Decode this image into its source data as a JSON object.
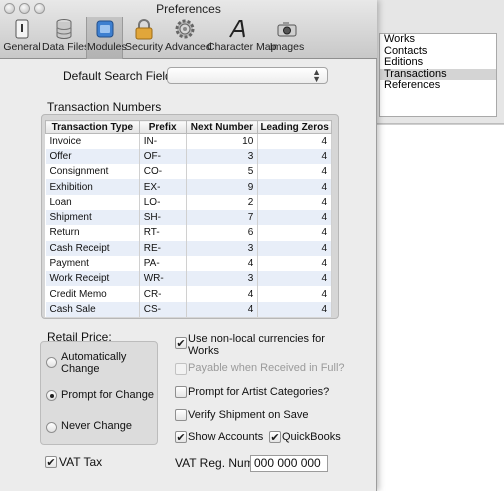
{
  "window": {
    "title": "Preferences",
    "toolbar": [
      {
        "label": "General",
        "icon": "general-icon"
      },
      {
        "label": "Data Files",
        "icon": "database-icon"
      },
      {
        "label": "Modules",
        "icon": "modules-icon",
        "selected": true
      },
      {
        "label": "Security",
        "icon": "lock-icon"
      },
      {
        "label": "Advanced",
        "icon": "gear-icon"
      },
      {
        "label": "Character Map",
        "icon": "character-map-icon"
      },
      {
        "label": "Images",
        "icon": "camera-icon"
      }
    ]
  },
  "default_search": {
    "label": "Default Search Field:",
    "value": ""
  },
  "transactions": {
    "title": "Transaction Numbers",
    "headers": [
      "Transaction Type",
      "Prefix",
      "Next Number",
      "Leading Zeros"
    ],
    "rows": [
      {
        "type": "Invoice",
        "prefix": "IN-",
        "next": "10",
        "zeros": "4"
      },
      {
        "type": "Offer",
        "prefix": "OF-",
        "next": "3",
        "zeros": "4"
      },
      {
        "type": "Consignment",
        "prefix": "CO-",
        "next": "5",
        "zeros": "4"
      },
      {
        "type": "Exhibition",
        "prefix": "EX-",
        "next": "9",
        "zeros": "4"
      },
      {
        "type": "Loan",
        "prefix": "LO-",
        "next": "2",
        "zeros": "4"
      },
      {
        "type": "Shipment",
        "prefix": "SH-",
        "next": "7",
        "zeros": "4"
      },
      {
        "type": "Return",
        "prefix": "RT-",
        "next": "6",
        "zeros": "4"
      },
      {
        "type": "Cash Receipt",
        "prefix": "RE-",
        "next": "3",
        "zeros": "4"
      },
      {
        "type": "Payment",
        "prefix": "PA-",
        "next": "4",
        "zeros": "4"
      },
      {
        "type": "Work Receipt",
        "prefix": "WR-",
        "next": "3",
        "zeros": "4"
      },
      {
        "type": "Credit Memo",
        "prefix": "CR-",
        "next": "4",
        "zeros": "4"
      },
      {
        "type": "Cash Sale",
        "prefix": "CS-",
        "next": "4",
        "zeros": "4"
      }
    ]
  },
  "retail_price": {
    "label": "Retail Price:",
    "options": [
      {
        "label": "Automatically Change",
        "selected": false
      },
      {
        "label": "Prompt for Change",
        "selected": true
      },
      {
        "label": "Never Change",
        "selected": false
      }
    ]
  },
  "checkboxes": {
    "non_local": {
      "label": "Use non-local currencies for Works",
      "checked": true
    },
    "payable": {
      "label": "Payable when Received in Full?",
      "checked": false,
      "disabled": true
    },
    "artist_categories": {
      "label": "Prompt for Artist Categories?",
      "checked": false
    },
    "verify_shipment": {
      "label": "Verify Shipment on Save",
      "checked": false
    },
    "show_accounts": {
      "label": "Show Accounts",
      "checked": true
    },
    "quickbooks": {
      "label": "QuickBooks",
      "checked": true
    },
    "vat_tax": {
      "label": "VAT Tax",
      "checked": true
    }
  },
  "vat_reg": {
    "label": "VAT Reg. Num.",
    "value": "000 000 000"
  },
  "background_list": {
    "items": [
      "Works",
      "Contacts",
      "Editions",
      "Transactions",
      "References"
    ],
    "selected": "Transactions"
  }
}
